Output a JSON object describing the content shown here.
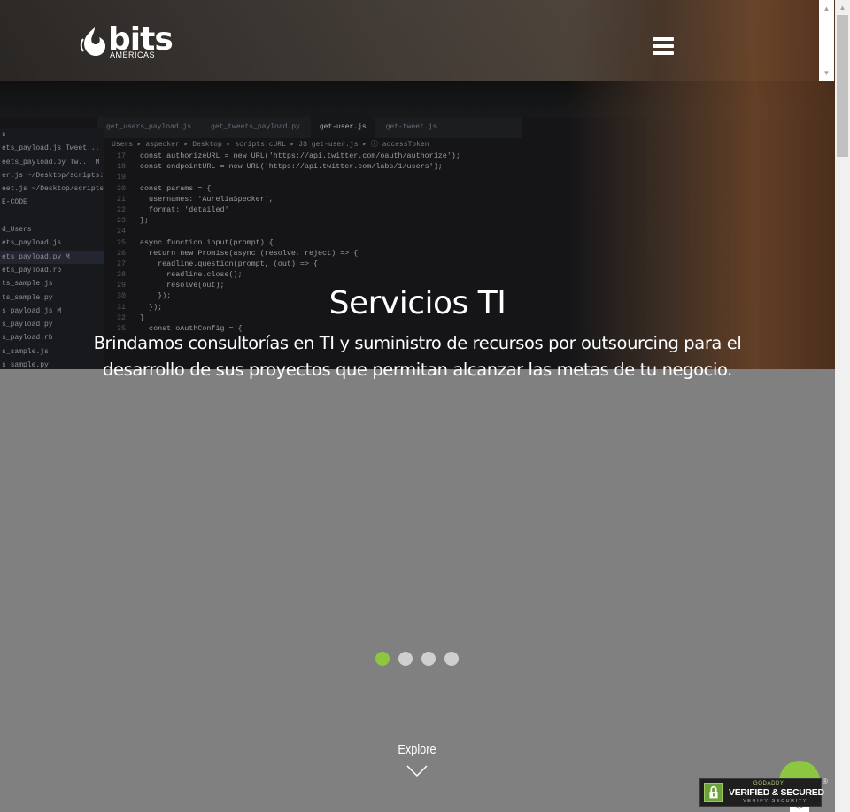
{
  "header": {
    "logo_word": "bits",
    "logo_sub": "AMERICAS"
  },
  "hero": {
    "editor_tabs": [
      "get_users_payload.js",
      "get_tweets_payload.py",
      "get-user.js",
      "get-tweet.js"
    ],
    "breadcrumb": "Users ▸ aspecker ▸ Desktop ▸ scripts:cURL ▸ JS get-user.js ▸ ⓘ accessToken",
    "sidebar_files": [
      "s",
      "ets_payload.js  Tweet... M",
      "eets_payload.py  Tw... M",
      "er.js ~/Desktop/scripts:cURL",
      "eet.js ~/Desktop/scripts:c...",
      "E-CODE",
      "",
      "d_Users",
      "ets_payload.js",
      "ets_payload.py        M",
      "ets_payload.rb",
      "ts_sample.js",
      "ts_sample.py",
      "s_payload.js          M",
      "s_payload.py",
      "s_payload.rb",
      "s_sample.js",
      "s_sample.py"
    ],
    "code_lines": [
      {
        "n": "17",
        "t": "const authorizeURL = new URL('https://api.twitter.com/oauth/authorize');"
      },
      {
        "n": "18",
        "t": "const endpointURL = new URL('https://api.twitter.com/labs/1/users');"
      },
      {
        "n": "19",
        "t": ""
      },
      {
        "n": "20",
        "t": "const params = {"
      },
      {
        "n": "21",
        "t": "  usernames: 'AureliaSpecker',"
      },
      {
        "n": "22",
        "t": "  format: 'detailed'"
      },
      {
        "n": "23",
        "t": "};"
      },
      {
        "n": "24",
        "t": ""
      },
      {
        "n": "25",
        "t": "async function input(prompt) {"
      },
      {
        "n": "26",
        "t": "  return new Promise(async (resolve, reject) => {"
      },
      {
        "n": "27",
        "t": "    readline.question(prompt, (out) => {"
      },
      {
        "n": "28",
        "t": "      readline.close();"
      },
      {
        "n": "29",
        "t": "      resolve(out);"
      },
      {
        "n": "30",
        "t": "    });"
      },
      {
        "n": "31",
        "t": "  });"
      },
      {
        "n": "32",
        "t": "}"
      },
      {
        "n": "35",
        "t": "  const oAuthConfig = {"
      }
    ]
  },
  "slide": {
    "title": "Servicios TI",
    "description": "Brindamos consultorías en TI y suministro de recursos por outsourcing para el desarrollo de sus proyectos que permitan alcanzar las metas de tu negocio."
  },
  "slider": {
    "dot_count": 4,
    "active_index": 0
  },
  "explore": {
    "label": "Explore"
  },
  "seal": {
    "brand": "GODADDY",
    "line1": "VERIFIED & SECURED",
    "line2": "VERIFY SECURITY",
    "reg": "®"
  },
  "colors": {
    "accent_green": "#8dc63f",
    "background_gray": "#808080"
  },
  "icons": {
    "menu": "hamburger-icon",
    "explore": "chevron-down-icon",
    "contact": "mail-icon",
    "seal": "lock-icon"
  }
}
